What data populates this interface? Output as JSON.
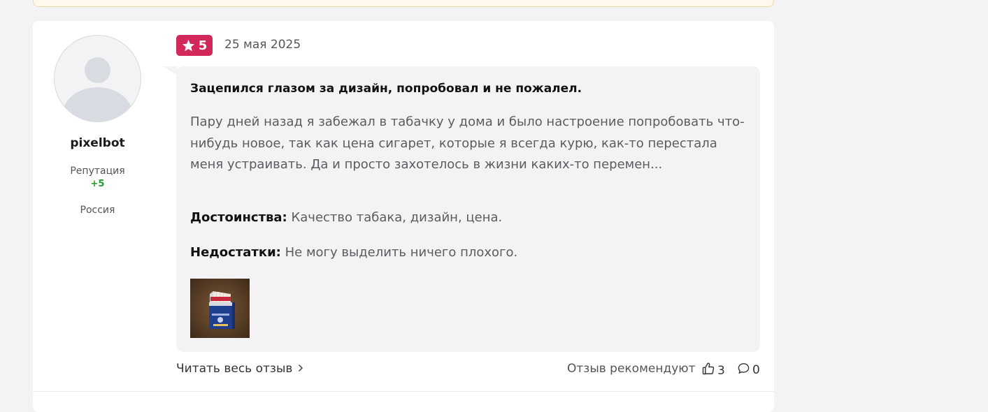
{
  "user": {
    "name": "pixelbot",
    "reputation_label": "Репутация",
    "reputation_value": "+5",
    "country": "Россия"
  },
  "review": {
    "rating": "5",
    "date": "25 мая 2025",
    "title": "Зацепился глазом за дизайн, попробовал и не пожалел.",
    "text": "Пару дней назад я забежал в табачку у дома и было настроение попробовать что-нибудь новое, так как цена сигарет, которые я всегда курю, как-то перестала меня устраивать. Да и просто захотелось в жизни каких-то перемен...",
    "pros_label": "Достоинства:",
    "pros": "Качество табака, дизайн, цена.",
    "cons_label": "Недостатки:",
    "cons": "Не могу выделить ничего плохого."
  },
  "footer": {
    "read_full": "Читать весь отзыв",
    "recommend_label": "Отзыв рекомендуют",
    "likes": "3",
    "comments": "0"
  },
  "colors": {
    "accent": "#d2285a",
    "reputation": "#1e9e2a",
    "bubble": "#f3f3f6"
  },
  "icons": [
    "star-icon",
    "chevron-right-icon",
    "thumbs-up-icon",
    "comment-icon"
  ]
}
